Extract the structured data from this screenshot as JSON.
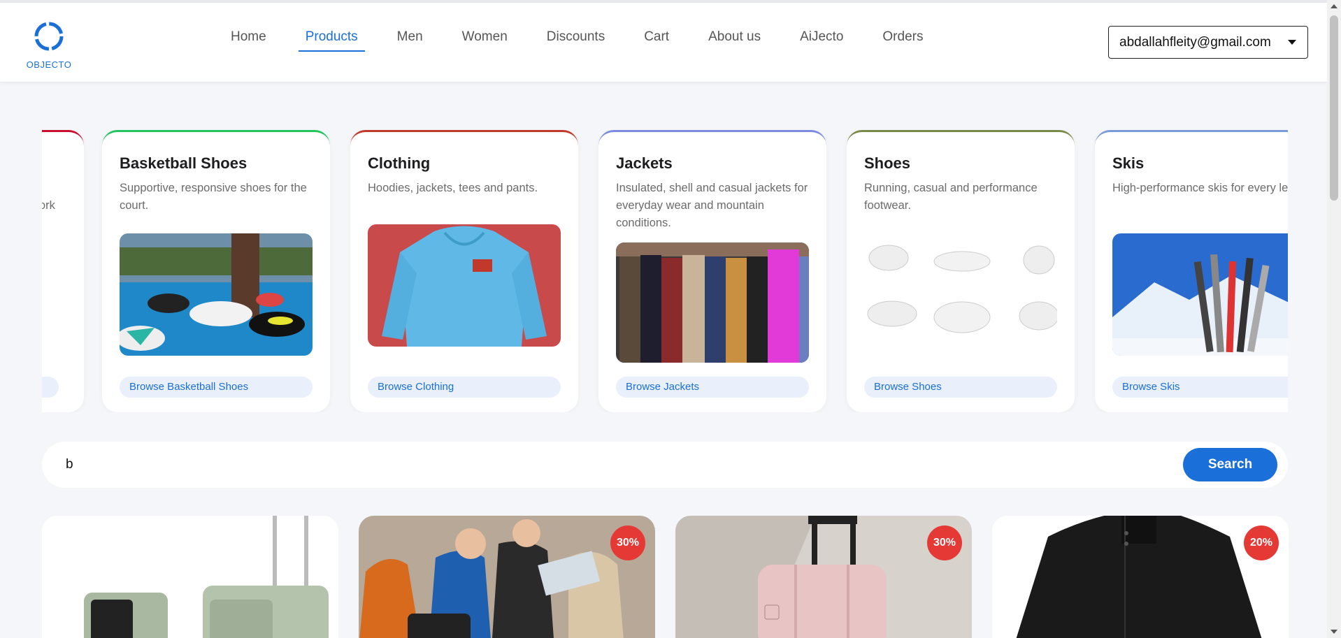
{
  "brand": {
    "name": "OBJECTO"
  },
  "nav": {
    "items": [
      {
        "label": "Home"
      },
      {
        "label": "Products"
      },
      {
        "label": "Men"
      },
      {
        "label": "Women"
      },
      {
        "label": "Discounts"
      },
      {
        "label": "Cart"
      },
      {
        "label": "About us"
      },
      {
        "label": "AiJecto"
      },
      {
        "label": "Orders"
      }
    ],
    "active": "Products"
  },
  "user": {
    "email": "abdallahfleity@gmail.com"
  },
  "categories": [
    {
      "title": "",
      "desc": "work",
      "button": "",
      "accent": "#c8102e"
    },
    {
      "title": "Basketball Shoes",
      "desc": "Supportive, responsive shoes for the court.",
      "button": "Browse Basketball Shoes",
      "accent": "#22c55e"
    },
    {
      "title": "Clothing",
      "desc": "Hoodies, jackets, tees and pants.",
      "button": "Browse Clothing",
      "accent": "#c0392b"
    },
    {
      "title": "Jackets",
      "desc": "Insulated, shell and casual jackets for everyday wear and mountain conditions.",
      "button": "Browse Jackets",
      "accent": "#7b8ce0"
    },
    {
      "title": "Shoes",
      "desc": "Running, casual and performance footwear.",
      "button": "Browse Shoes",
      "accent": "#7a8a4a"
    },
    {
      "title": "Skis",
      "desc": "High-performance skis for every level.",
      "button": "Browse Skis",
      "accent": "#7a9ad8"
    }
  ],
  "search": {
    "value": "b",
    "button": "Search"
  },
  "products": [
    {
      "badge": ""
    },
    {
      "badge": "30%"
    },
    {
      "badge": "30%"
    },
    {
      "badge": "20%"
    }
  ],
  "colors": {
    "accent": "#1a6fd8",
    "badge": "#e53935",
    "background": "#f4f6f9"
  }
}
